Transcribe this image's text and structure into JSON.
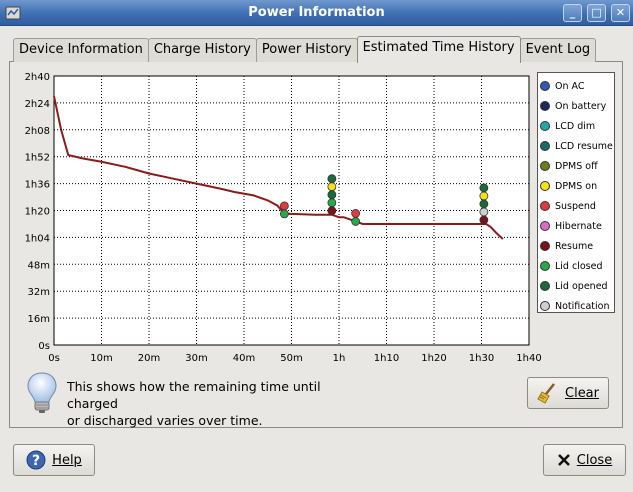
{
  "window": {
    "title": "Power Information",
    "controls": [
      "_",
      "□",
      "✕"
    ]
  },
  "tabs": [
    {
      "label": "Device Information",
      "active": false
    },
    {
      "label": "Charge History",
      "active": false
    },
    {
      "label": "Power History",
      "active": false
    },
    {
      "label": "Estimated Time History",
      "active": true
    },
    {
      "label": "Event Log",
      "active": false
    }
  ],
  "chart_data": {
    "type": "line",
    "title": "",
    "xlabel": "",
    "ylabel": "",
    "x_ticks": [
      "0s",
      "10m",
      "20m",
      "30m",
      "40m",
      "50m",
      "1h",
      "1h10",
      "1h20",
      "1h30",
      "1h40"
    ],
    "y_ticks": [
      "0s",
      "16m",
      "32m",
      "48m",
      "1h04",
      "1h20",
      "1h36",
      "1h52",
      "2h08",
      "2h24",
      "2h40"
    ],
    "xlim_minutes": [
      0,
      100
    ],
    "ylim_minutes": [
      0,
      160
    ],
    "grid": true,
    "line_color": "#8b1c1c",
    "series": [
      {
        "x_minutes": [
          0,
          1.5,
          3,
          6,
          10,
          15,
          20,
          25,
          30,
          35,
          38,
          42,
          45,
          47,
          48.5,
          50,
          55,
          58.5,
          60,
          61,
          63,
          65,
          70,
          75,
          80,
          85,
          90,
          91,
          92,
          93,
          94.5
        ],
        "y_minutes": [
          148,
          128,
          113,
          111,
          109,
          106,
          102,
          99,
          96,
          93,
          91,
          89,
          86,
          83,
          78,
          78,
          77.5,
          77.5,
          76,
          76,
          74,
          72,
          72,
          72,
          72,
          72,
          72,
          72,
          70,
          67,
          63
        ]
      }
    ],
    "events": [
      {
        "x_minutes": 48.5,
        "type": "Suspend"
      },
      {
        "x_minutes": 48.5,
        "type": "Lid closed"
      },
      {
        "x_minutes": 58.5,
        "type": "Lid opened"
      },
      {
        "x_minutes": 58.5,
        "type": "DPMS on"
      },
      {
        "x_minutes": 58.5,
        "type": "Lid opened"
      },
      {
        "x_minutes": 58.5,
        "type": "Lid closed"
      },
      {
        "x_minutes": 58.5,
        "type": "Resume"
      },
      {
        "x_minutes": 63.5,
        "type": "Suspend"
      },
      {
        "x_minutes": 63.5,
        "type": "Lid closed"
      },
      {
        "x_minutes": 90.5,
        "type": "Lid opened"
      },
      {
        "x_minutes": 90.5,
        "type": "DPMS on"
      },
      {
        "x_minutes": 90.5,
        "type": "Lid opened"
      },
      {
        "x_minutes": 90.5,
        "type": "Notification"
      },
      {
        "x_minutes": 90.5,
        "type": "Resume"
      }
    ],
    "legend_placement": "right",
    "legend": [
      {
        "label": "On AC",
        "color": "#2f58b5"
      },
      {
        "label": "On battery",
        "color": "#1a2a5a"
      },
      {
        "label": "LCD dim",
        "color": "#1fa8a8"
      },
      {
        "label": "LCD resume",
        "color": "#1a6a66"
      },
      {
        "label": "DPMS off",
        "color": "#6b7f16"
      },
      {
        "label": "DPMS on",
        "color": "#f2e21a"
      },
      {
        "label": "Suspend",
        "color": "#e23a3a"
      },
      {
        "label": "Hibernate",
        "color": "#d96cc6"
      },
      {
        "label": "Resume",
        "color": "#7a1414"
      },
      {
        "label": "Lid closed",
        "color": "#27a84a"
      },
      {
        "label": "Lid opened",
        "color": "#1a6b3a"
      },
      {
        "label": "Notification",
        "color": "#cfcfcf"
      }
    ]
  },
  "info": {
    "text_line1": "This shows how the remaining time until charged",
    "text_line2": "or discharged varies over time."
  },
  "buttons": {
    "clear": "Clear",
    "help": "Help",
    "close": "Close"
  },
  "icons": {
    "bulb": "lightbulb-icon",
    "clear": "broom-icon",
    "help": "help-icon",
    "close": "close-icon"
  }
}
